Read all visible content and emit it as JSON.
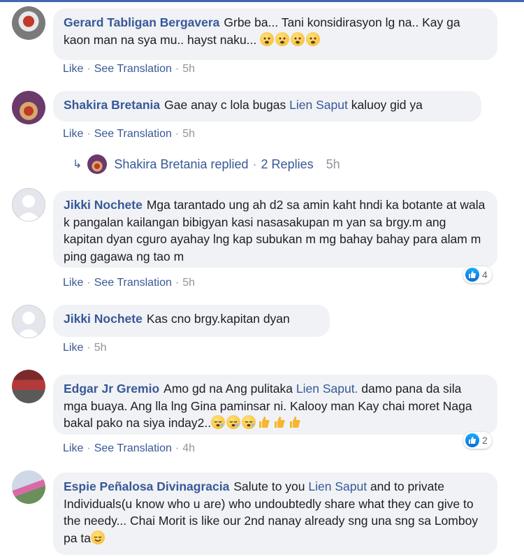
{
  "comments": [
    {
      "author": "Gerard Tabligan Bergavera",
      "text": "Grbe ba... Tani konsidirasyon lg na.. Kay ga kaon man na sya mu.. hayst naku...",
      "emoji_count": 4,
      "like": "Like",
      "translate": "See Translation",
      "time": "5h"
    },
    {
      "author": "Shakira Bretania",
      "text_before": "Gae anay c lola bugas",
      "mention": "Lien Saput",
      "text_after": "kaluoy gid ya",
      "like": "Like",
      "translate": "See Translation",
      "time": "5h",
      "replies": {
        "name": "Shakira Bretania",
        "replied": "replied",
        "count_label": "2 Replies",
        "time": "5h"
      }
    },
    {
      "author": "Jikki Nochete",
      "text": "Mga tarantado ung ah d2 sa amin kaht hndi ka botante at wala k pangalan kailangan bibigyan kasi nasasakupan m yan sa brgy.m ang kapitan dyan cguro ayahay lng kap subukan m mg bahay bahay para alam m ping gagawa ng tao m",
      "like": "Like",
      "translate": "See Translation",
      "time": "5h",
      "reactions": "4"
    },
    {
      "author": "Jikki Nochete",
      "text": "Kas cno brgy.kapitan dyan",
      "like": "Like",
      "time": "5h"
    },
    {
      "author": "Edgar Jr Gremio",
      "text_before": "Amo gd na Ang pulitaka",
      "mention": "Lien Saput.",
      "text_after": "damo pana da sila mga buaya. Ang lla lng Gina paminsar ni. Kalooy man Kay chai moret Naga bakal pako na siya inday2..",
      "like": "Like",
      "translate": "See Translation",
      "time": "4h",
      "reactions": "2"
    },
    {
      "author": "Espie Peñalosa Divinagracia",
      "text_before": "Salute to you",
      "mention": "Lien Saput",
      "text_after": "and to private Individuals(u know who u are) who undoubtedly share what they can give to the needy... Chai Morit is like our 2nd nanay already sng una sng sa Lomboy pa ta"
    }
  ],
  "colors": {
    "link": "#385898",
    "bubble": "#f0f2f5",
    "meta": "#90949c",
    "like_blue": "#1877f2"
  }
}
